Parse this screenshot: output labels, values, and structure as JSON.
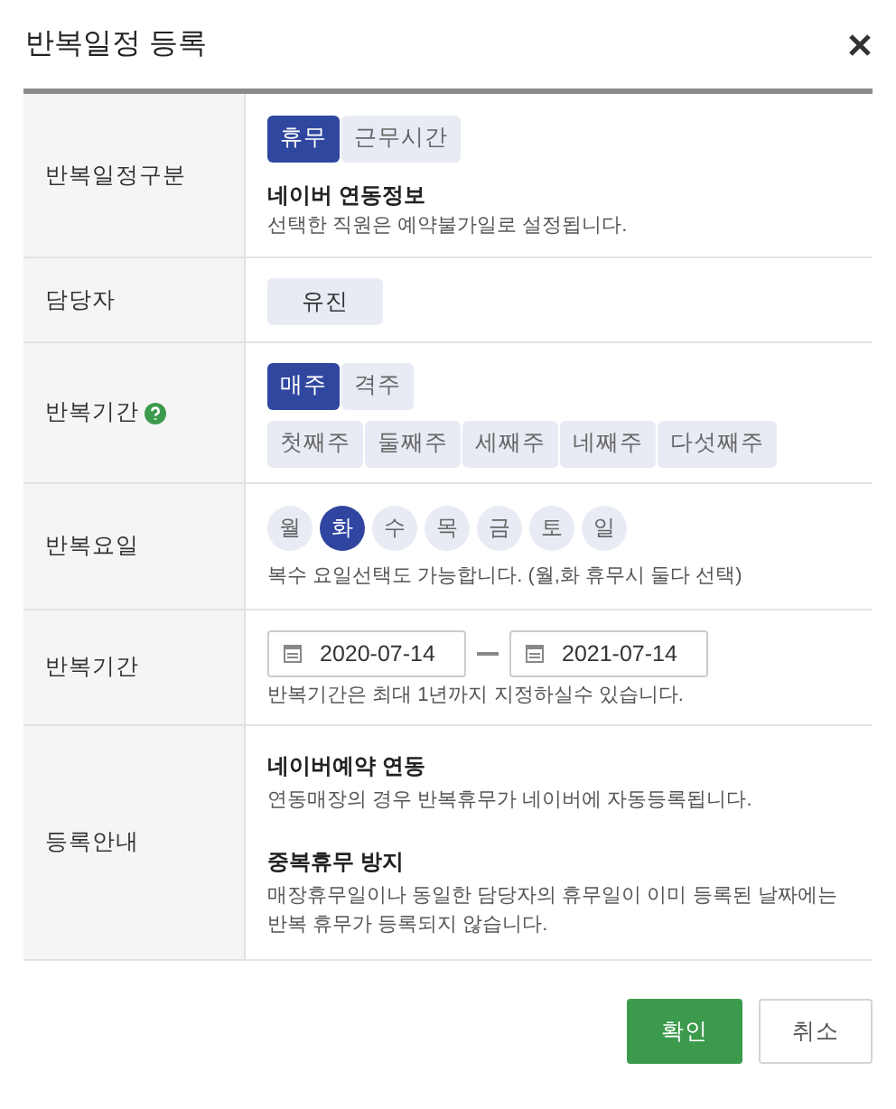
{
  "dialog": {
    "title": "반복일정 등록"
  },
  "rows": [
    {
      "kind": "type",
      "label": "반복일정구분",
      "toggle": [
        {
          "label": "휴무",
          "selected": true
        },
        {
          "label": "근무시간",
          "selected": false
        }
      ],
      "note_title": "네이버 연동정보",
      "note": "선택한 직원은 예약불가일로 설정됩니다."
    },
    {
      "kind": "staff",
      "label": "담당자",
      "staff": "유진"
    },
    {
      "kind": "period",
      "label": "반복기간",
      "help": true,
      "toggle": [
        {
          "label": "매주",
          "selected": true
        },
        {
          "label": "격주",
          "selected": false
        }
      ],
      "weeks": [
        {
          "label": "첫째주",
          "selected": false
        },
        {
          "label": "둘째주",
          "selected": false
        },
        {
          "label": "세째주",
          "selected": false
        },
        {
          "label": "네째주",
          "selected": false
        },
        {
          "label": "다섯째주",
          "selected": false
        }
      ]
    },
    {
      "kind": "days",
      "label": "반복요일",
      "days": [
        {
          "label": "월",
          "selected": false
        },
        {
          "label": "화",
          "selected": true
        },
        {
          "label": "수",
          "selected": false
        },
        {
          "label": "목",
          "selected": false
        },
        {
          "label": "금",
          "selected": false
        },
        {
          "label": "토",
          "selected": false
        },
        {
          "label": "일",
          "selected": false
        }
      ],
      "note": "복수 요일선택도 가능합니다. (월,화 휴무시 둘다 선택)"
    },
    {
      "kind": "range",
      "label": "반복기간",
      "start": "2020-07-14",
      "end": "2021-07-14",
      "note": "반복기간은 최대 1년까지 지정하실수 있습니다."
    },
    {
      "kind": "info",
      "label": "등록안내",
      "sections": [
        {
          "title": "네이버예약 연동",
          "text": "연동매장의 경우 반복휴무가 네이버에 자동등록됩니다."
        },
        {
          "title": "중복휴무 방지",
          "text": "매장휴무일이나 동일한 담당자의 휴무일이 이미 등록된 날짜에는 반복 휴무가 등록되지 않습니다."
        }
      ]
    }
  ],
  "buttons": [
    {
      "label": "확인",
      "kind": "primary"
    },
    {
      "label": "취소",
      "kind": "secondary"
    }
  ]
}
